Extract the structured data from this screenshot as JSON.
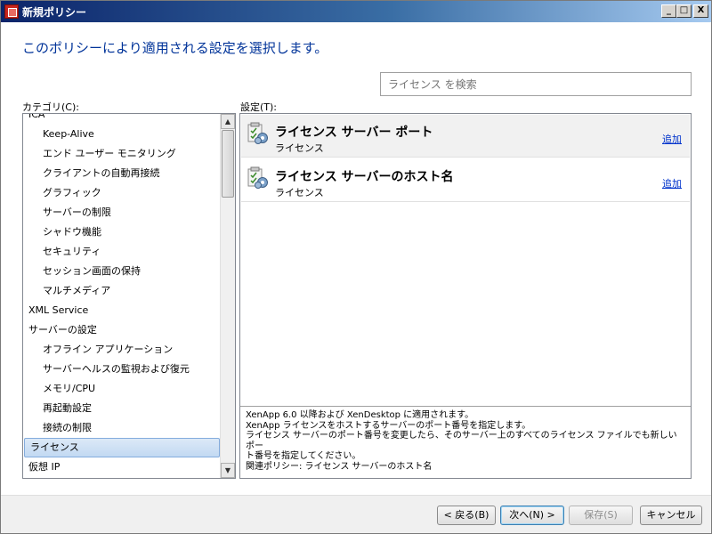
{
  "window": {
    "title": "新規ポリシー",
    "controls": {
      "minimize": "_",
      "maximize": "□",
      "close": "X"
    }
  },
  "heading": "このポリシーにより適用される設定を選択します。",
  "search": {
    "placeholder": "ライセンス を検索"
  },
  "category_label": "カテゴリ(C):",
  "settings_label": "設定(T):",
  "categories": [
    {
      "label": "ICA",
      "level": 0
    },
    {
      "label": "Keep-Alive",
      "level": 1
    },
    {
      "label": "エンド ユーザー モニタリング",
      "level": 1
    },
    {
      "label": "クライアントの自動再接続",
      "level": 1
    },
    {
      "label": "グラフィック",
      "level": 1
    },
    {
      "label": "サーバーの制限",
      "level": 1
    },
    {
      "label": "シャドウ機能",
      "level": 1
    },
    {
      "label": "セキュリティ",
      "level": 1
    },
    {
      "label": "セッション画面の保持",
      "level": 1
    },
    {
      "label": "マルチメディア",
      "level": 1
    },
    {
      "label": "XML Service",
      "level": 0
    },
    {
      "label": "サーバーの設定",
      "level": 0
    },
    {
      "label": "オフライン アプリケーション",
      "level": 1
    },
    {
      "label": "サーバーヘルスの監視および復元",
      "level": 1
    },
    {
      "label": "メモリ/CPU",
      "level": 1
    },
    {
      "label": "再起動設定",
      "level": 1
    },
    {
      "label": "接続の制限",
      "level": 1
    },
    {
      "label": "ライセンス",
      "level": 0,
      "selected": true
    },
    {
      "label": "仮想 IP",
      "level": 0
    }
  ],
  "settings": [
    {
      "title": "ライセンス サーバー ポート",
      "category": "ライセンス",
      "action": "追加"
    },
    {
      "title": "ライセンス サーバーのホスト名",
      "category": "ライセンス",
      "action": "追加"
    }
  ],
  "description": {
    "line1": "XenApp 6.0 以降および XenDesktop に適用されます。",
    "line2": "XenApp ライセンスをホストするサーバーのポート番号を指定します。",
    "line3": "ライセンス サーバーのポート番号を変更したら、そのサーバー上のすべてのライセンス ファイルでも新しいポー",
    "line4": "ト番号を指定してください。",
    "line5": "関連ポリシー: ライセンス サーバーのホスト名"
  },
  "footer": {
    "back": "< 戻る(B)",
    "next": "次へ(N) >",
    "save": "保存(S)",
    "cancel": "キャンセル"
  },
  "colors": {
    "heading": "#003399",
    "link": "#0033cc",
    "selection": "#c2d9f2"
  },
  "icons": {
    "setting_icon": "policy-setting-gear-icon",
    "app_icon": "citrix-app-icon"
  }
}
